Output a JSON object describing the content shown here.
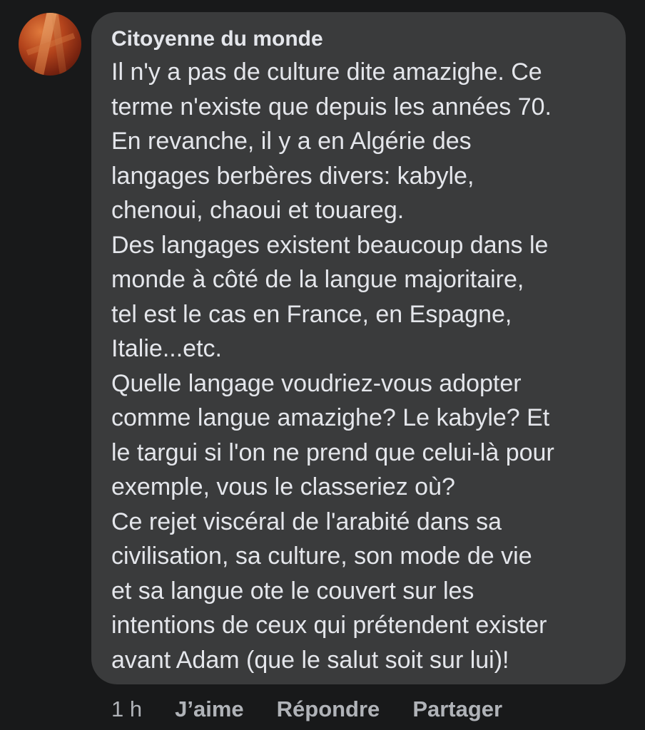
{
  "comment": {
    "author": "Citoyenne du monde",
    "lines": [
      "Il n'y a pas de culture dite amazighe. Ce",
      "terme n'existe que depuis les années 70.",
      "En revanche, il y a en Algérie des",
      "langages berbères divers: kabyle,",
      "chenoui, chaoui et touareg.",
      "Des langages existent beaucoup dans le",
      "monde à côté de la langue majoritaire,",
      "tel est le cas en France, en Espagne,",
      "Italie...etc.",
      "Quelle langage voudriez-vous adopter",
      "comme langue amazighe? Le kabyle? Et",
      "le targui si l'on ne prend que celui-là pour",
      "exemple, vous le classeriez où?",
      "Ce rejet viscéral de l'arabité dans sa",
      "civilisation, sa culture, son mode de vie",
      "et sa langue ote le couvert sur les",
      "intentions de ceux qui prétendent exister",
      "avant Adam (que le salut soit sur lui)!"
    ]
  },
  "actions": {
    "timestamp": "1 h",
    "like_label": "J’aime",
    "reply_label": "Répondre",
    "share_label": "Partager"
  },
  "colors": {
    "background": "#18191a",
    "bubble": "#3a3b3c",
    "primary_text": "#e4e6eb",
    "secondary_text": "#b0b3b8"
  }
}
